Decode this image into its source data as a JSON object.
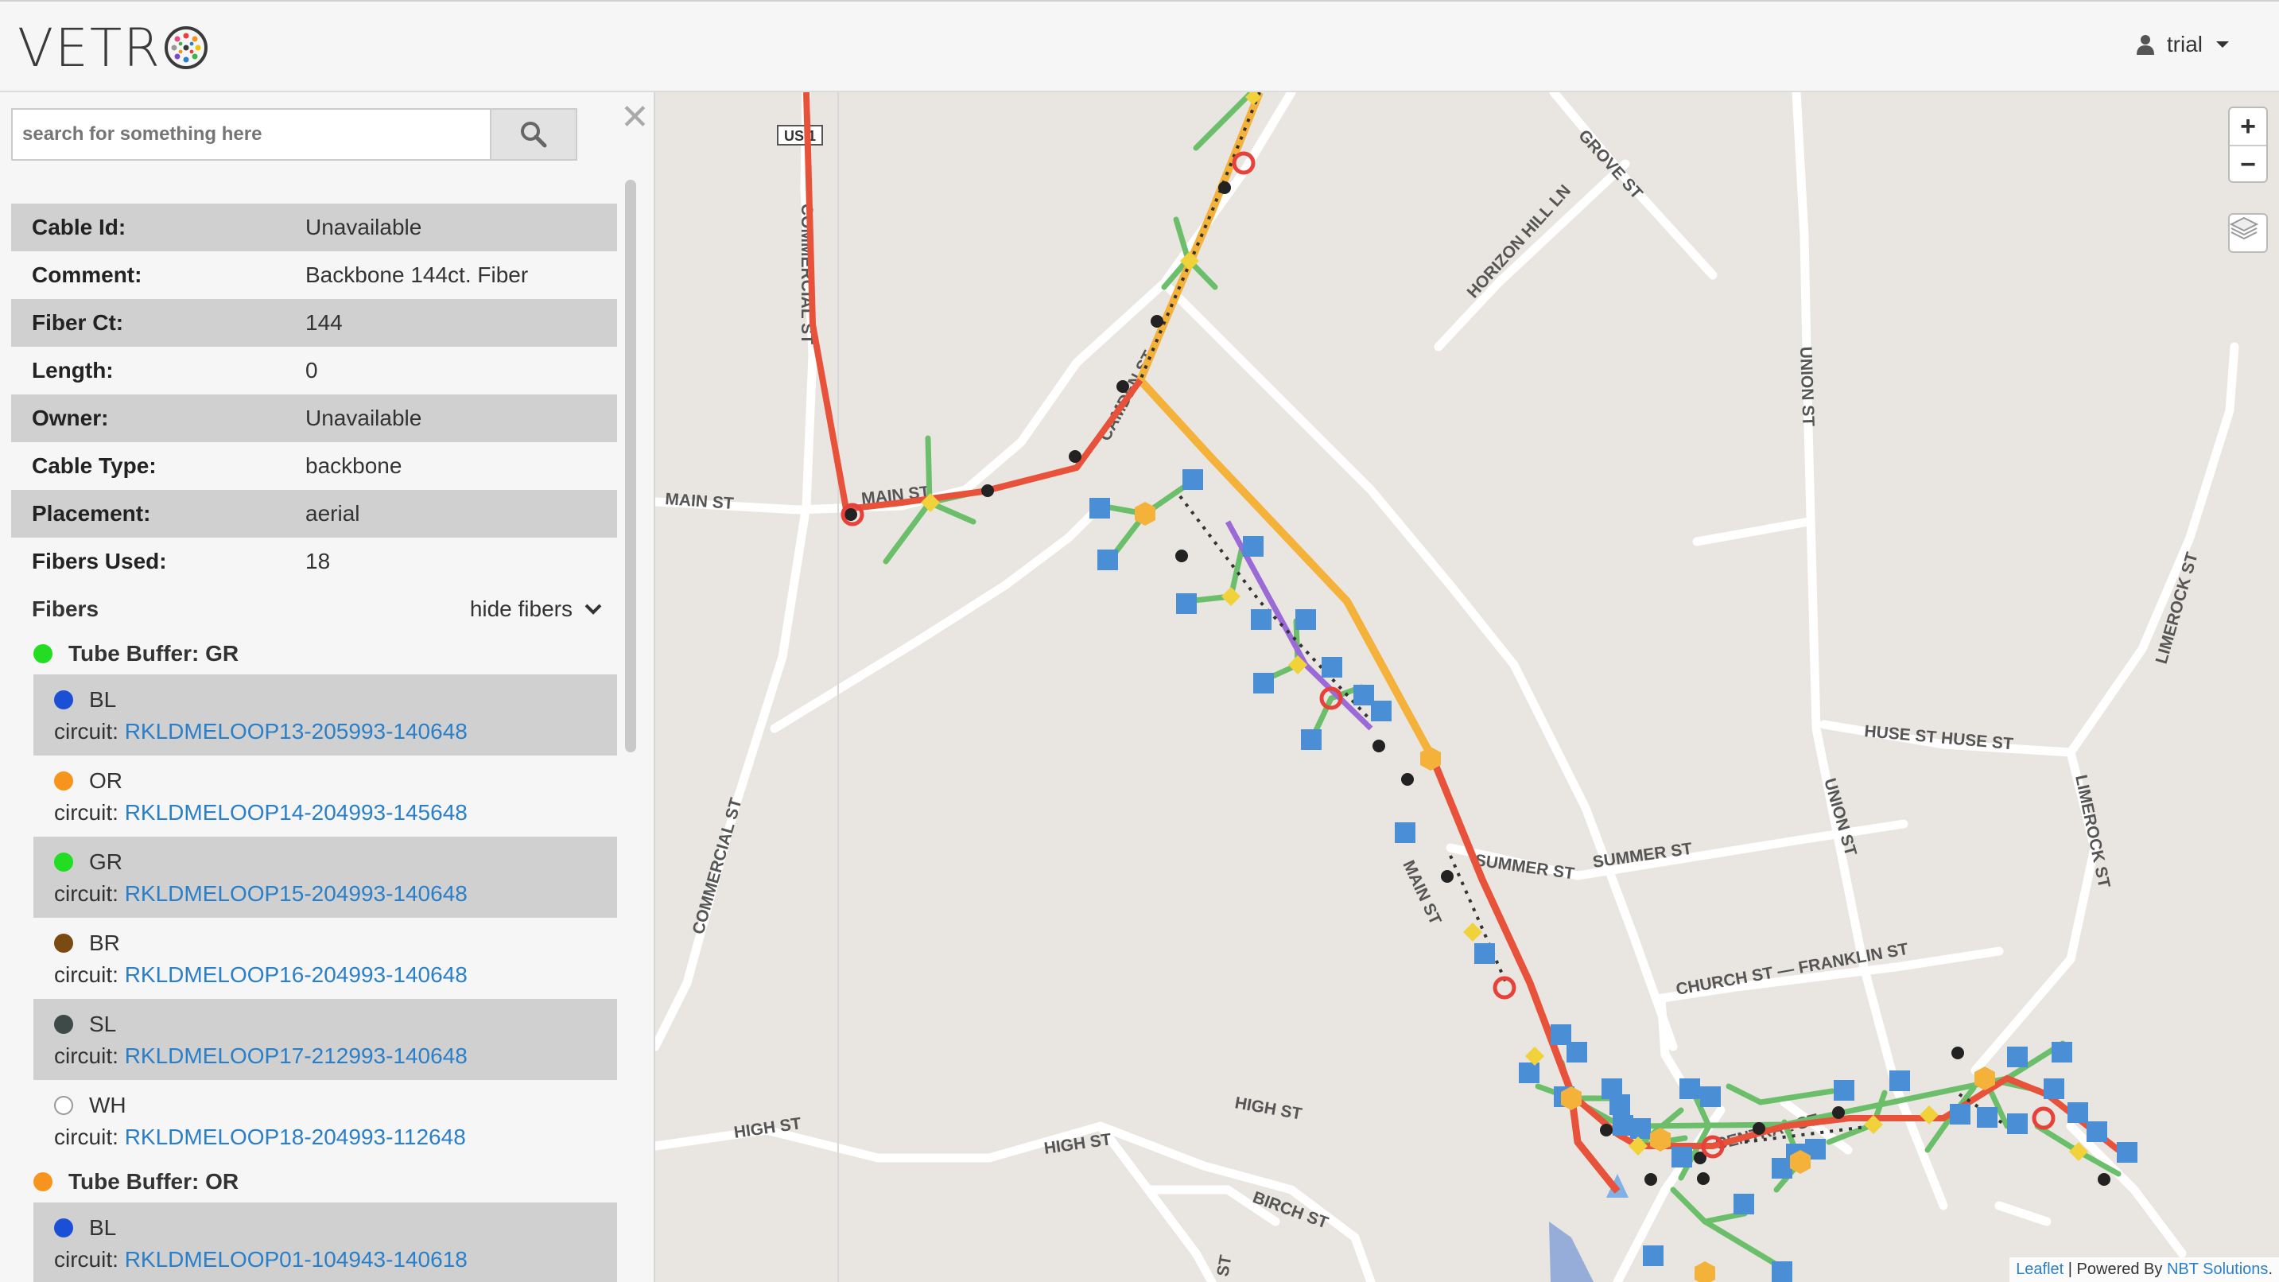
{
  "header": {
    "logo_text": "VETR",
    "user_label": "trial"
  },
  "sidebar": {
    "search_placeholder": "search for something here",
    "properties": [
      {
        "key": "Cable Id:",
        "value": "Unavailable"
      },
      {
        "key": "Comment:",
        "value": "Backbone 144ct. Fiber"
      },
      {
        "key": "Fiber Ct:",
        "value": "144"
      },
      {
        "key": "Length:",
        "value": "0"
      },
      {
        "key": "Owner:",
        "value": "Unavailable"
      },
      {
        "key": "Cable Type:",
        "value": "backbone"
      },
      {
        "key": "Placement:",
        "value": "aerial"
      },
      {
        "key": "Fibers Used:",
        "value": "18"
      }
    ],
    "fibers_label": "Fibers",
    "hide_fibers_label": "hide fibers",
    "tube_gr": {
      "label": "Tube Buffer: GR",
      "color": "#22dd22"
    },
    "tube_or": {
      "label": "Tube Buffer: OR",
      "color": "#f7941d"
    },
    "circuit_prefix": "circuit:",
    "fibers": [
      {
        "code": "BL",
        "color": "#1a4fd6",
        "circuit": "RKLDMELOOP13-205993-140648"
      },
      {
        "code": "OR",
        "color": "#f7941d",
        "circuit": "RKLDMELOOP14-204993-145648"
      },
      {
        "code": "GR",
        "color": "#22dd22",
        "circuit": "RKLDMELOOP15-204993-140648"
      },
      {
        "code": "BR",
        "color": "#7a4a12",
        "circuit": "RKLDMELOOP16-204993-140648"
      },
      {
        "code": "SL",
        "color": "#3d4a48",
        "circuit": "RKLDMELOOP17-212993-140648"
      },
      {
        "code": "WH",
        "color": "#ffffff",
        "circuit": "RKLDMELOOP18-204993-112648"
      }
    ],
    "tube_or_first_fiber": {
      "code": "BL",
      "color": "#1a4fd6",
      "circuit": "RKLDMELOOP01-104943-140618"
    }
  },
  "map": {
    "streets": [
      "GROVE ST",
      "HORIZON HILL LN",
      "UNION ST",
      "MAIN ST",
      "MAIN ST",
      "COMMERCIAL ST",
      "COMMERCIAL ST",
      "CAMDEN ST",
      "US 1",
      "HUSE ST HUSE ST",
      "LIMEROCK ST",
      "LIMEROCK ST",
      "SUMMER ST",
      "SUMMER ST",
      "UNION ST",
      "CHURCH ST — FRANKLIN ST",
      "HIGH ST",
      "HIGH ST",
      "HIGH ST",
      "BIRCH ST",
      "CENTRAL ST",
      "MAIN ST",
      "ST"
    ],
    "zoom_in": "+",
    "zoom_out": "−",
    "attribution_leaflet": "Leaflet",
    "attribution_sep": " | Powered By ",
    "attribution_nbt": "NBT Solutions",
    "attribution_end": "."
  }
}
